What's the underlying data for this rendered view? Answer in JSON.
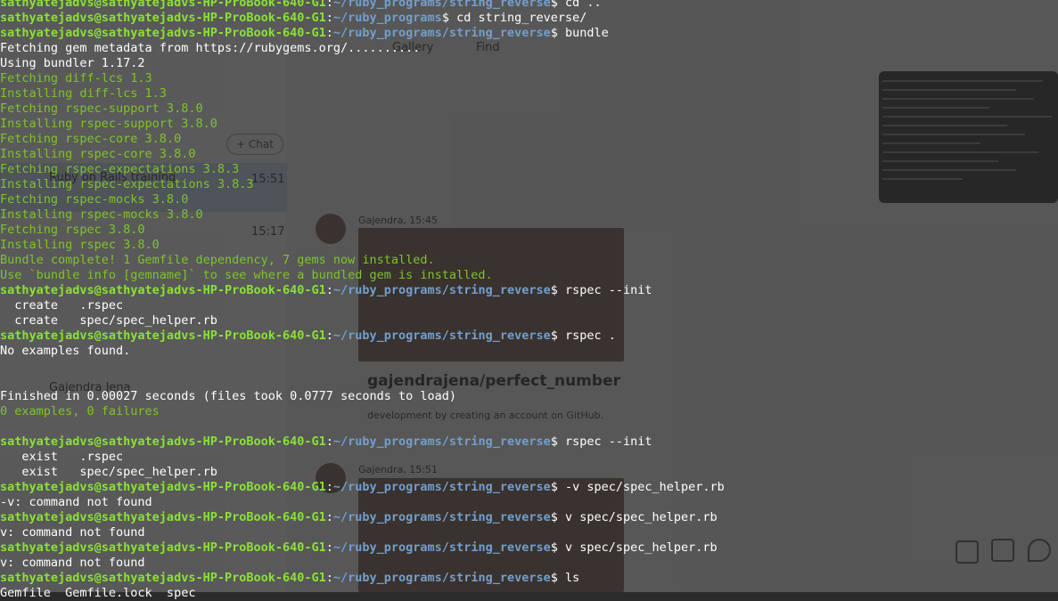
{
  "terminal": {
    "user_host": "sathyatejadvs@sathyatejadvs-HP-ProBook-640-G1",
    "lines": [
      {
        "kind": "prompt",
        "path": "~/ruby_programs/string_reverse",
        "cmd": "cd .."
      },
      {
        "kind": "prompt",
        "path": "~/ruby_programs",
        "cmd": "cd string_reverse/"
      },
      {
        "kind": "prompt",
        "path": "~/ruby_programs/string_reverse",
        "cmd": "bundle"
      },
      {
        "kind": "out",
        "text": "Fetching gem metadata from https://rubygems.org/.........."
      },
      {
        "kind": "out",
        "text": "Using bundler 1.17.2"
      },
      {
        "kind": "green",
        "text": "Fetching diff-lcs 1.3"
      },
      {
        "kind": "green",
        "text": "Installing diff-lcs 1.3"
      },
      {
        "kind": "green",
        "text": "Fetching rspec-support 3.8.0"
      },
      {
        "kind": "green",
        "text": "Installing rspec-support 3.8.0"
      },
      {
        "kind": "green",
        "text": "Fetching rspec-core 3.8.0"
      },
      {
        "kind": "green",
        "text": "Installing rspec-core 3.8.0"
      },
      {
        "kind": "green",
        "text": "Fetching rspec-expectations 3.8.3"
      },
      {
        "kind": "green",
        "text": "Installing rspec-expectations 3.8.3"
      },
      {
        "kind": "green",
        "text": "Fetching rspec-mocks 3.8.0"
      },
      {
        "kind": "green",
        "text": "Installing rspec-mocks 3.8.0"
      },
      {
        "kind": "green",
        "text": "Fetching rspec 3.8.0"
      },
      {
        "kind": "green",
        "text": "Installing rspec 3.8.0"
      },
      {
        "kind": "green",
        "text": "Bundle complete! 1 Gemfile dependency, 7 gems now installed."
      },
      {
        "kind": "green",
        "text": "Use `bundle info [gemname]` to see where a bundled gem is installed."
      },
      {
        "kind": "prompt",
        "path": "~/ruby_programs/string_reverse",
        "cmd": "rspec --init"
      },
      {
        "kind": "out",
        "text": "  create   .rspec"
      },
      {
        "kind": "out",
        "text": "  create   spec/spec_helper.rb"
      },
      {
        "kind": "prompt",
        "path": "~/ruby_programs/string_reverse",
        "cmd": "rspec ."
      },
      {
        "kind": "out",
        "text": "No examples found."
      },
      {
        "kind": "out",
        "text": ""
      },
      {
        "kind": "out",
        "text": ""
      },
      {
        "kind": "out",
        "text": "Finished in 0.00027 seconds (files took 0.0777 seconds to load)"
      },
      {
        "kind": "green",
        "text": "0 examples, 0 failures"
      },
      {
        "kind": "out",
        "text": ""
      },
      {
        "kind": "prompt",
        "path": "~/ruby_programs/string_reverse",
        "cmd": "rspec --init"
      },
      {
        "kind": "out",
        "text": "   exist   .rspec"
      },
      {
        "kind": "out",
        "text": "   exist   spec/spec_helper.rb"
      },
      {
        "kind": "prompt",
        "path": "~/ruby_programs/string_reverse",
        "cmd": "-v spec/spec_helper.rb"
      },
      {
        "kind": "out",
        "text": "-v: command not found"
      },
      {
        "kind": "prompt",
        "path": "~/ruby_programs/string_reverse",
        "cmd": "v spec/spec_helper.rb"
      },
      {
        "kind": "out",
        "text": "v: command not found"
      },
      {
        "kind": "prompt",
        "path": "~/ruby_programs/string_reverse",
        "cmd": "v spec/spec_helper.rb"
      },
      {
        "kind": "out",
        "text": "v: command not found"
      },
      {
        "kind": "prompt",
        "path": "~/ruby_programs/string_reverse",
        "cmd": "ls"
      },
      {
        "kind": "out",
        "text": "Gemfile  Gemfile.lock  spec"
      }
    ]
  },
  "background_app": {
    "chat_button": "+ Chat",
    "tab_gallery": "Gallery",
    "tab_find": "Find",
    "sel_item": "Ruby on Rails training",
    "sel_time": "15:51",
    "item2_time": "15:17",
    "msg_author": "Gajendra, 15:45",
    "msg_author2": "Gajendra, 15:51",
    "repo_title": "gajendrajena/perfect_number",
    "repo_desc": "development by creating an account on GitHub.",
    "contact": "Gajendra Jena"
  },
  "colors": {
    "user": "#8ae234",
    "path": "#729fcf",
    "green_output": "#7fc42a",
    "text": "#ffffff",
    "background": "#2b2b2b"
  }
}
